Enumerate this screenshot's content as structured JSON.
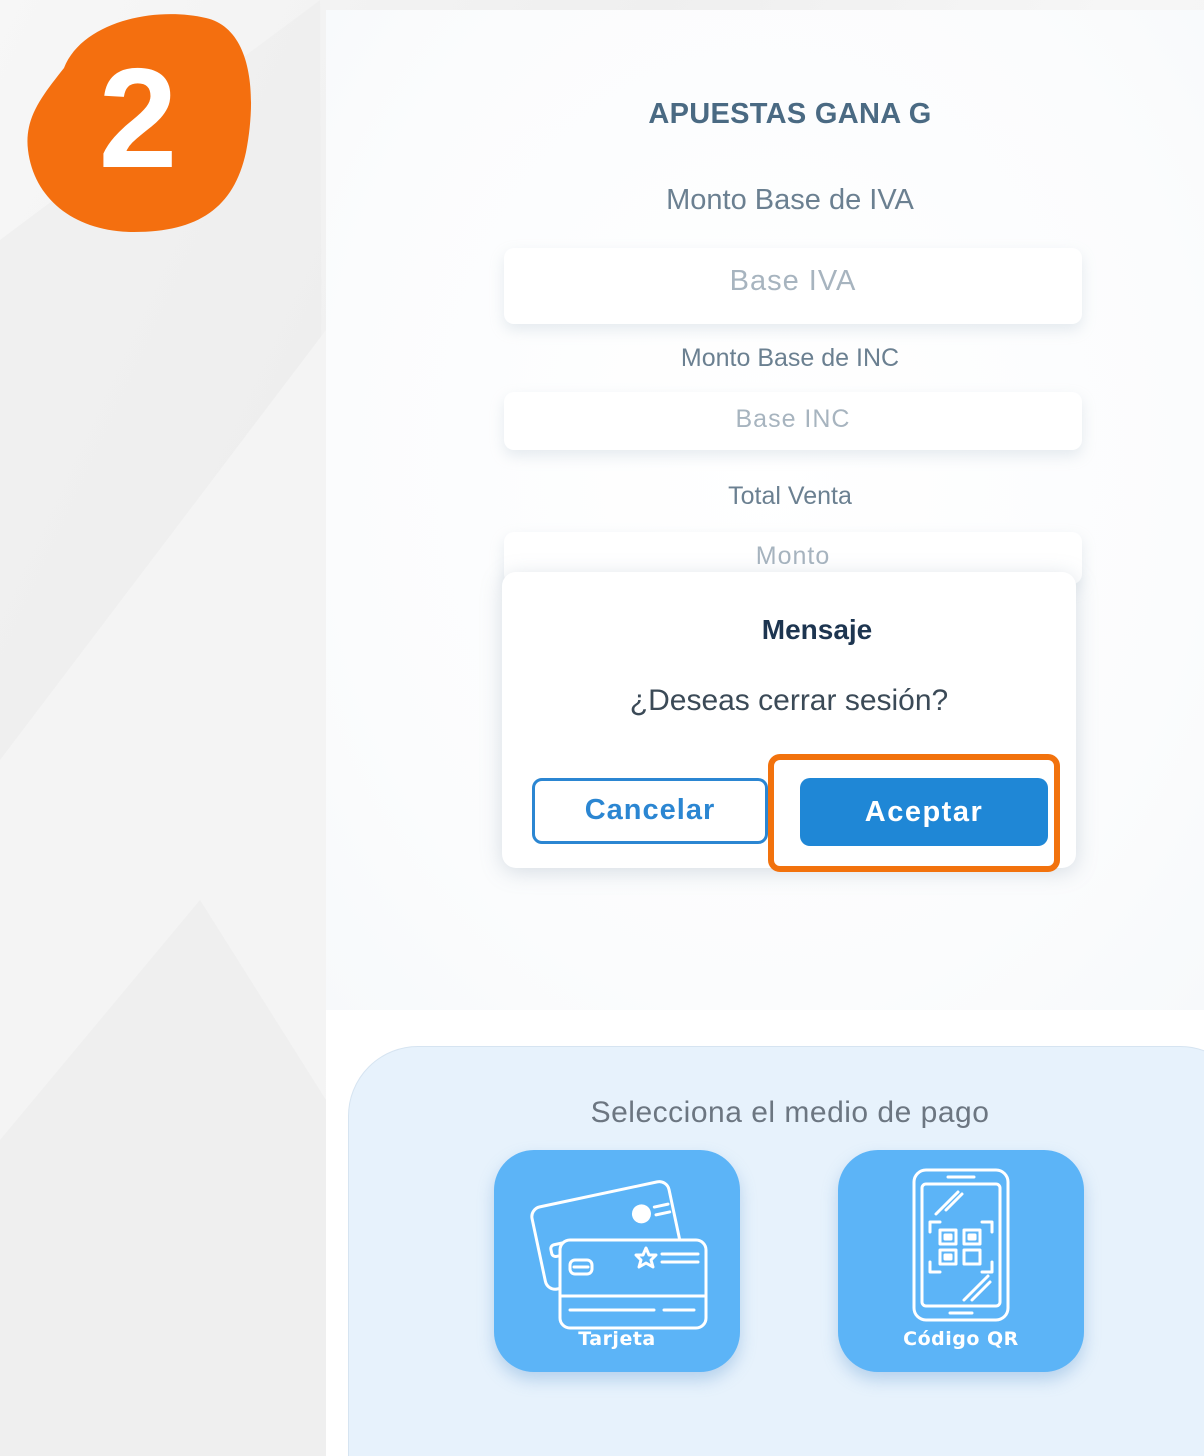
{
  "step": {
    "number": "2",
    "color": "#f2720d"
  },
  "form": {
    "company": "APUESTAS GANA G",
    "fields": [
      {
        "label": "Monto Base de IVA",
        "placeholder": "Base IVA"
      },
      {
        "label": "Monto Base de INC",
        "placeholder": "Base INC"
      },
      {
        "label": "Total Venta",
        "placeholder": "Monto"
      }
    ]
  },
  "dialog": {
    "title": "Mensaje",
    "message": "¿Deseas cerrar sesión?",
    "cancel_label": "Cancelar",
    "accept_label": "Aceptar",
    "accent_color": "#1f87d6",
    "highlight_color": "#f2720d"
  },
  "payment": {
    "title": "Selecciona el medio de pago",
    "options": [
      {
        "label": "Tarjeta",
        "icon": "credit-cards-icon"
      },
      {
        "label": "Código QR",
        "icon": "qr-code-phone-icon"
      }
    ]
  }
}
